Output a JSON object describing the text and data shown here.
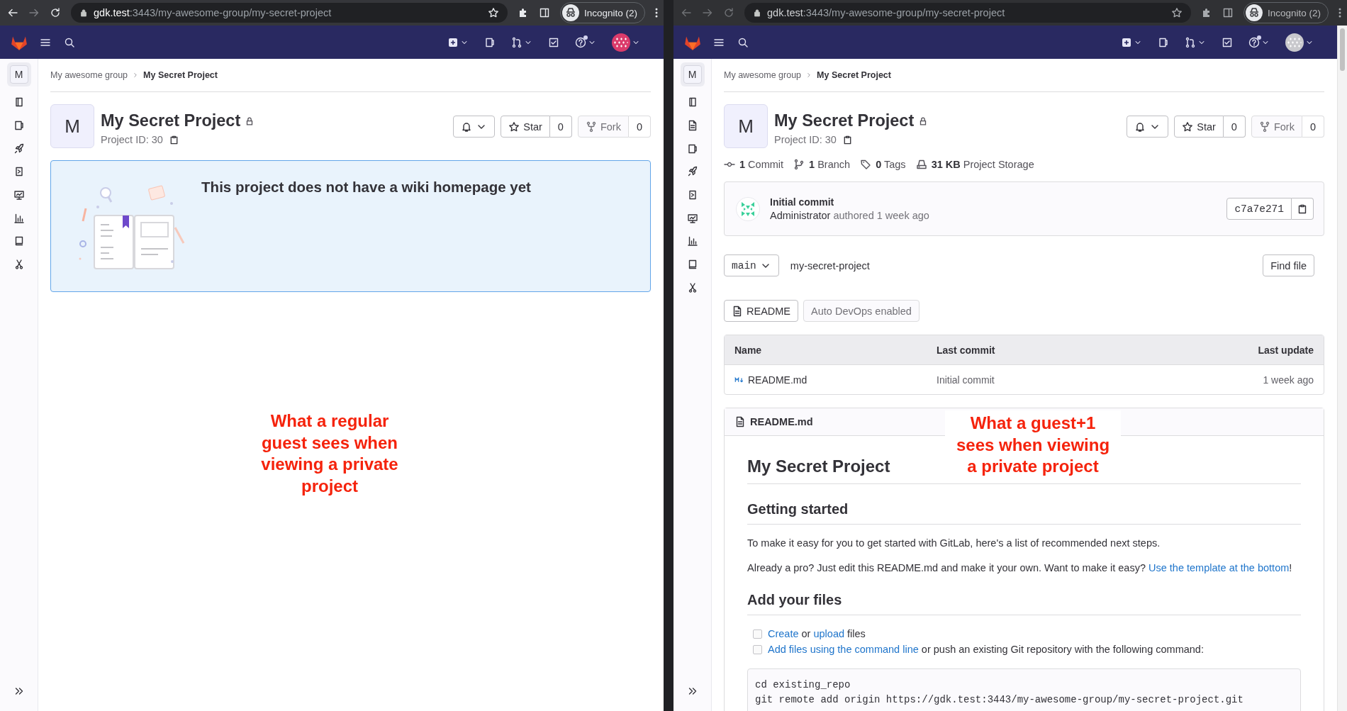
{
  "windows": [
    {
      "browser": {
        "focused": true,
        "host": "gdk.test",
        "path": ":3443/my-awesome-group/my-secret-project",
        "profile": "Incognito (2)"
      },
      "navbar": {
        "avatar": {
          "color": "#db3b6b"
        }
      },
      "sidebar": {
        "avatar": "M",
        "items": [
          {
            "kind": "overview"
          },
          {
            "kind": "issues"
          },
          {
            "kind": "deployments"
          },
          {
            "kind": "infrastructure"
          },
          {
            "kind": "monitor"
          },
          {
            "kind": "analytics"
          },
          {
            "kind": "wiki"
          },
          {
            "kind": "snippets"
          }
        ]
      },
      "breadcrumb": [
        {
          "label": "My awesome group",
          "current": false
        },
        {
          "label": "My Secret Project",
          "current": true
        }
      ],
      "project": {
        "avatar": "M",
        "title": "My Secret Project",
        "private": true,
        "id_label": "Project ID: 30",
        "star": {
          "label": "Star",
          "count": "0",
          "disabled": false
        },
        "fork": {
          "label": "Fork",
          "count": "0",
          "disabled": true
        }
      },
      "wiki_empty": {
        "title": "This project does not have a wiki homepage yet"
      },
      "annotation": {
        "text": "What a regular guest sees when viewing a private project"
      }
    },
    {
      "browser": {
        "focused": false,
        "host": "gdk.test",
        "path": ":3443/my-awesome-group/my-secret-project",
        "profile": "Incognito (2)"
      },
      "navbar": {
        "avatar": {
          "color": "#c9c9cd"
        }
      },
      "scrollbar": true,
      "sidebar": {
        "avatar": "M",
        "items": [
          {
            "kind": "overview"
          },
          {
            "kind": "repository"
          },
          {
            "kind": "issues"
          },
          {
            "kind": "deployments"
          },
          {
            "kind": "infrastructure"
          },
          {
            "kind": "monitor"
          },
          {
            "kind": "analytics"
          },
          {
            "kind": "wiki"
          },
          {
            "kind": "snippets"
          }
        ]
      },
      "breadcrumb": [
        {
          "label": "My awesome group",
          "current": false
        },
        {
          "label": "My Secret Project",
          "current": true
        }
      ],
      "project": {
        "avatar": "M",
        "title": "My Secret Project",
        "private": true,
        "id_label": "Project ID: 30",
        "star": {
          "label": "Star",
          "count": "0",
          "disabled": false
        },
        "fork": {
          "label": "Fork",
          "count": "0",
          "disabled": true
        }
      },
      "stats": [
        {
          "kind": "commits",
          "count": "1",
          "label": "Commit"
        },
        {
          "kind": "branches",
          "count": "1",
          "label": "Branch"
        },
        {
          "kind": "tags",
          "count": "0",
          "label": "Tags"
        },
        {
          "kind": "storage",
          "count": "31 KB",
          "label": "Project Storage"
        }
      ],
      "last_commit": {
        "title": "Initial commit",
        "author": "Administrator",
        "verb": "authored",
        "time": "1 week ago",
        "sha": "c7a7e271"
      },
      "tree": {
        "branch": "main",
        "path": "my-secret-project",
        "find_button": "Find file"
      },
      "file_buttons": [
        {
          "kind": "readme",
          "label": "README",
          "disabled": false
        },
        {
          "kind": "plain",
          "label": "Auto DevOps enabled",
          "disabled": true
        }
      ],
      "files": {
        "columns": [
          "Name",
          "Last commit",
          "Last update"
        ],
        "rows": [
          {
            "name": "README.md",
            "last_commit": "Initial commit",
            "last_update": "1 week ago"
          }
        ]
      },
      "readme": {
        "filename": "README.md",
        "blocks": [
          {
            "kind": "h1",
            "text": "My Secret Project"
          },
          {
            "kind": "h2",
            "text": "Getting started"
          },
          {
            "kind": "p",
            "parts": [
              {
                "text": "To make it easy for you to get started with GitLab, here's a list of recommended next steps."
              }
            ]
          },
          {
            "kind": "p",
            "parts": [
              {
                "text": "Already a pro? Just edit this README.md and make it your own. Want to make it easy? "
              },
              {
                "text": "Use the template at the bottom",
                "link": true
              },
              {
                "text": "!"
              }
            ]
          },
          {
            "kind": "h2",
            "text": "Add your files"
          },
          {
            "kind": "tasks",
            "items": [
              {
                "checked": false,
                "parts": [
                  {
                    "text": "Create",
                    "link": true
                  },
                  {
                    "text": " or "
                  },
                  {
                    "text": "upload",
                    "link": true
                  },
                  {
                    "text": " files"
                  }
                ]
              },
              {
                "checked": false,
                "parts": [
                  {
                    "text": "Add files using the command line",
                    "link": true
                  },
                  {
                    "text": " or push an existing Git repository with the following command:"
                  }
                ]
              }
            ]
          },
          {
            "kind": "code",
            "lines": [
              "cd existing_repo",
              "git remote add origin https://gdk.test:3443/my-awesome-group/my-secret-project.git"
            ]
          }
        ]
      },
      "annotation": {
        "text": "What a guest+1 sees when viewing a private project"
      }
    }
  ]
}
